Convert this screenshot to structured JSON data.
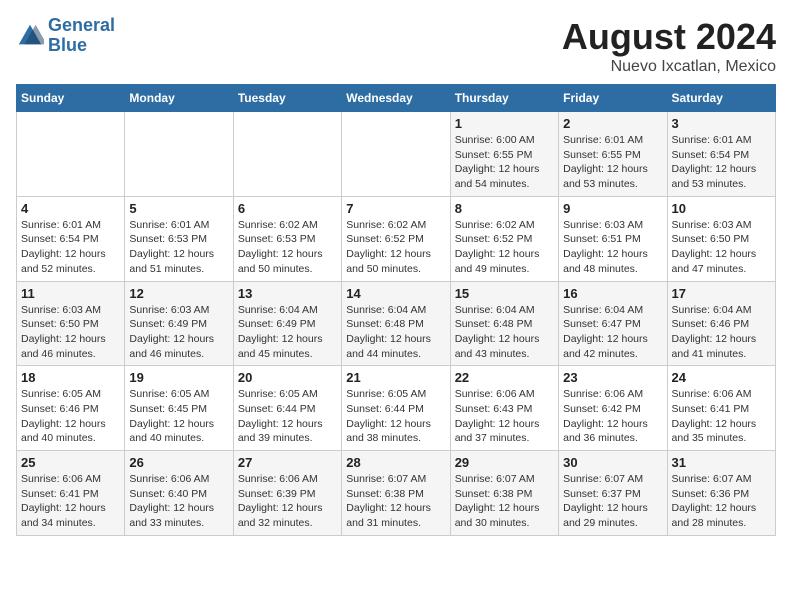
{
  "header": {
    "logo_line1": "General",
    "logo_line2": "Blue",
    "title": "August 2024",
    "subtitle": "Nuevo Ixcatlan, Mexico"
  },
  "weekdays": [
    "Sunday",
    "Monday",
    "Tuesday",
    "Wednesday",
    "Thursday",
    "Friday",
    "Saturday"
  ],
  "weeks": [
    [
      {
        "day": "",
        "info": ""
      },
      {
        "day": "",
        "info": ""
      },
      {
        "day": "",
        "info": ""
      },
      {
        "day": "",
        "info": ""
      },
      {
        "day": "1",
        "info": "Sunrise: 6:00 AM\nSunset: 6:55 PM\nDaylight: 12 hours\nand 54 minutes."
      },
      {
        "day": "2",
        "info": "Sunrise: 6:01 AM\nSunset: 6:55 PM\nDaylight: 12 hours\nand 53 minutes."
      },
      {
        "day": "3",
        "info": "Sunrise: 6:01 AM\nSunset: 6:54 PM\nDaylight: 12 hours\nand 53 minutes."
      }
    ],
    [
      {
        "day": "4",
        "info": "Sunrise: 6:01 AM\nSunset: 6:54 PM\nDaylight: 12 hours\nand 52 minutes."
      },
      {
        "day": "5",
        "info": "Sunrise: 6:01 AM\nSunset: 6:53 PM\nDaylight: 12 hours\nand 51 minutes."
      },
      {
        "day": "6",
        "info": "Sunrise: 6:02 AM\nSunset: 6:53 PM\nDaylight: 12 hours\nand 50 minutes."
      },
      {
        "day": "7",
        "info": "Sunrise: 6:02 AM\nSunset: 6:52 PM\nDaylight: 12 hours\nand 50 minutes."
      },
      {
        "day": "8",
        "info": "Sunrise: 6:02 AM\nSunset: 6:52 PM\nDaylight: 12 hours\nand 49 minutes."
      },
      {
        "day": "9",
        "info": "Sunrise: 6:03 AM\nSunset: 6:51 PM\nDaylight: 12 hours\nand 48 minutes."
      },
      {
        "day": "10",
        "info": "Sunrise: 6:03 AM\nSunset: 6:50 PM\nDaylight: 12 hours\nand 47 minutes."
      }
    ],
    [
      {
        "day": "11",
        "info": "Sunrise: 6:03 AM\nSunset: 6:50 PM\nDaylight: 12 hours\nand 46 minutes."
      },
      {
        "day": "12",
        "info": "Sunrise: 6:03 AM\nSunset: 6:49 PM\nDaylight: 12 hours\nand 46 minutes."
      },
      {
        "day": "13",
        "info": "Sunrise: 6:04 AM\nSunset: 6:49 PM\nDaylight: 12 hours\nand 45 minutes."
      },
      {
        "day": "14",
        "info": "Sunrise: 6:04 AM\nSunset: 6:48 PM\nDaylight: 12 hours\nand 44 minutes."
      },
      {
        "day": "15",
        "info": "Sunrise: 6:04 AM\nSunset: 6:48 PM\nDaylight: 12 hours\nand 43 minutes."
      },
      {
        "day": "16",
        "info": "Sunrise: 6:04 AM\nSunset: 6:47 PM\nDaylight: 12 hours\nand 42 minutes."
      },
      {
        "day": "17",
        "info": "Sunrise: 6:04 AM\nSunset: 6:46 PM\nDaylight: 12 hours\nand 41 minutes."
      }
    ],
    [
      {
        "day": "18",
        "info": "Sunrise: 6:05 AM\nSunset: 6:46 PM\nDaylight: 12 hours\nand 40 minutes."
      },
      {
        "day": "19",
        "info": "Sunrise: 6:05 AM\nSunset: 6:45 PM\nDaylight: 12 hours\nand 40 minutes."
      },
      {
        "day": "20",
        "info": "Sunrise: 6:05 AM\nSunset: 6:44 PM\nDaylight: 12 hours\nand 39 minutes."
      },
      {
        "day": "21",
        "info": "Sunrise: 6:05 AM\nSunset: 6:44 PM\nDaylight: 12 hours\nand 38 minutes."
      },
      {
        "day": "22",
        "info": "Sunrise: 6:06 AM\nSunset: 6:43 PM\nDaylight: 12 hours\nand 37 minutes."
      },
      {
        "day": "23",
        "info": "Sunrise: 6:06 AM\nSunset: 6:42 PM\nDaylight: 12 hours\nand 36 minutes."
      },
      {
        "day": "24",
        "info": "Sunrise: 6:06 AM\nSunset: 6:41 PM\nDaylight: 12 hours\nand 35 minutes."
      }
    ],
    [
      {
        "day": "25",
        "info": "Sunrise: 6:06 AM\nSunset: 6:41 PM\nDaylight: 12 hours\nand 34 minutes."
      },
      {
        "day": "26",
        "info": "Sunrise: 6:06 AM\nSunset: 6:40 PM\nDaylight: 12 hours\nand 33 minutes."
      },
      {
        "day": "27",
        "info": "Sunrise: 6:06 AM\nSunset: 6:39 PM\nDaylight: 12 hours\nand 32 minutes."
      },
      {
        "day": "28",
        "info": "Sunrise: 6:07 AM\nSunset: 6:38 PM\nDaylight: 12 hours\nand 31 minutes."
      },
      {
        "day": "29",
        "info": "Sunrise: 6:07 AM\nSunset: 6:38 PM\nDaylight: 12 hours\nand 30 minutes."
      },
      {
        "day": "30",
        "info": "Sunrise: 6:07 AM\nSunset: 6:37 PM\nDaylight: 12 hours\nand 29 minutes."
      },
      {
        "day": "31",
        "info": "Sunrise: 6:07 AM\nSunset: 6:36 PM\nDaylight: 12 hours\nand 28 minutes."
      }
    ]
  ]
}
